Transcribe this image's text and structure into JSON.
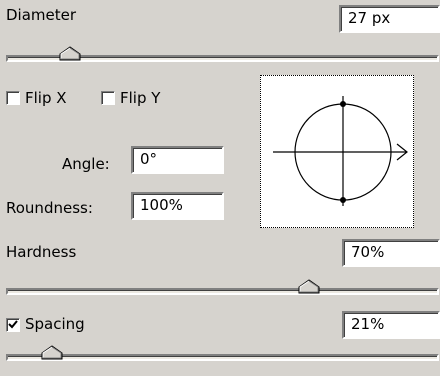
{
  "diameter": {
    "label": "Diameter",
    "value": "27 px",
    "slider_position": 0.147
  },
  "flip_x": {
    "label": "Flip X",
    "checked": false
  },
  "flip_y": {
    "label": "Flip Y",
    "checked": false
  },
  "angle": {
    "label": "Angle:",
    "value": "0°"
  },
  "roundness": {
    "label": "Roundness:",
    "value": "100%"
  },
  "hardness": {
    "label": "Hardness",
    "value": "70%",
    "slider_position": 0.7
  },
  "spacing": {
    "label": "Spacing",
    "checked": true,
    "value": "21%",
    "slider_position": 0.106
  },
  "icons": {
    "preview": "brush-tip-preview-icon",
    "arrow": "angle-arrow-icon"
  },
  "colors": {
    "background": "#d6d3ce",
    "field": "#ffffff",
    "shadow": "#808080",
    "highlight": "#ffffff"
  }
}
